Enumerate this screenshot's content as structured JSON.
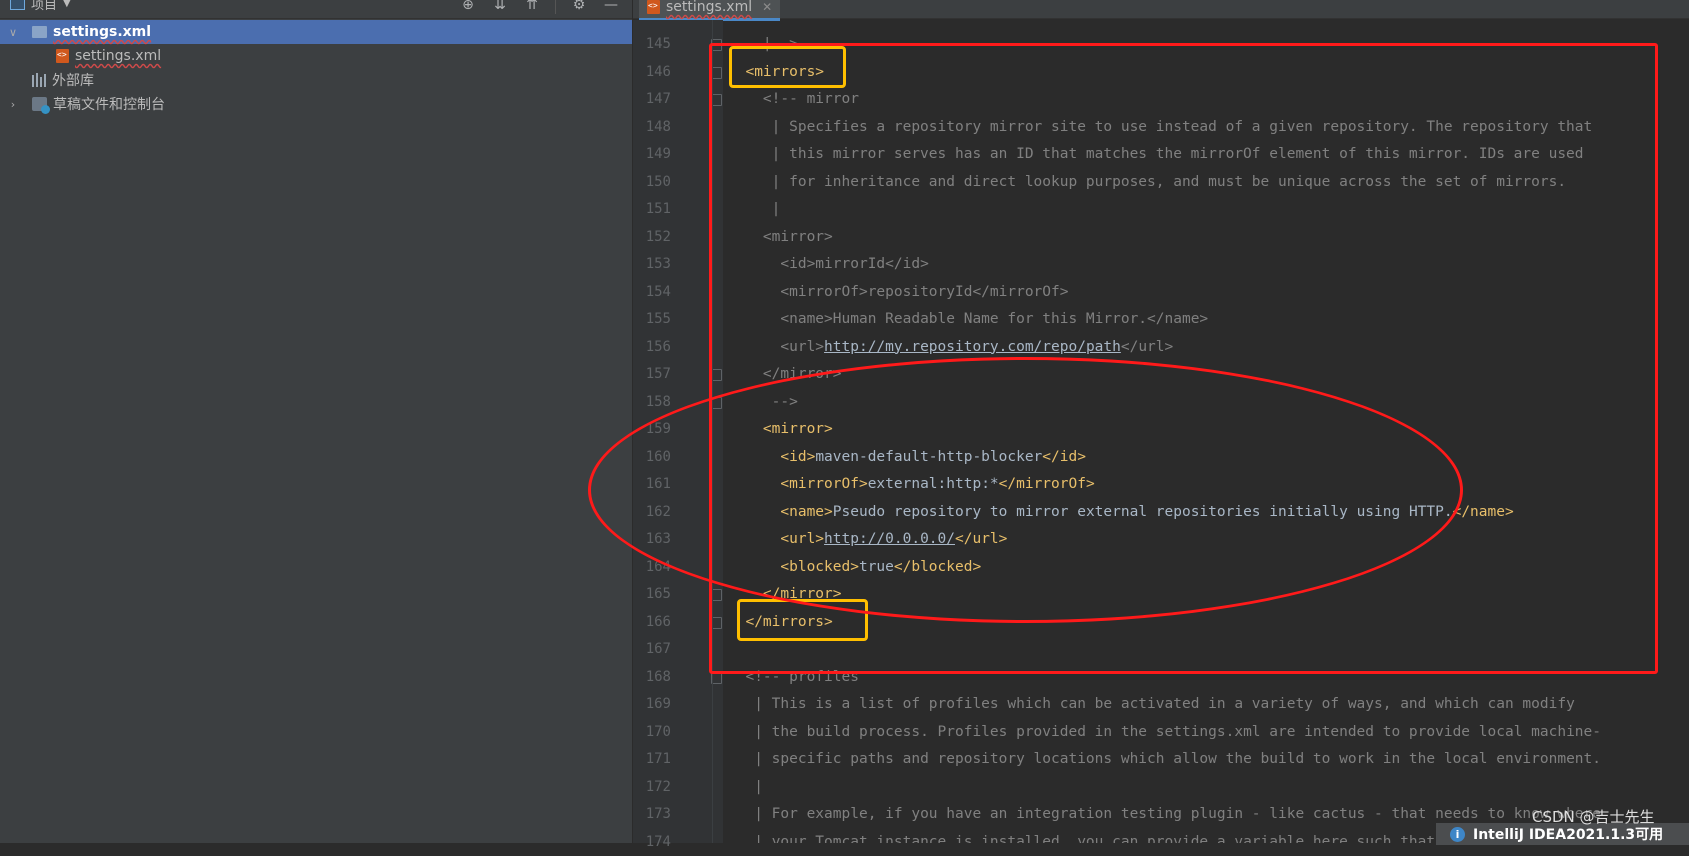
{
  "project_panel": {
    "title": "项目",
    "toolbar_icons": [
      "crosshair-icon",
      "expand-all-icon",
      "collapse-all-icon",
      "gear-icon",
      "minimize-icon"
    ],
    "tree": [
      {
        "label": "settings.xml",
        "type": "folder",
        "expanded": true,
        "selected": true
      },
      {
        "label": "settings.xml",
        "type": "xml-file"
      },
      {
        "label": "外部库",
        "type": "library"
      },
      {
        "label": "草稿文件和控制台",
        "type": "scratches",
        "expanded": false
      }
    ]
  },
  "editor": {
    "tab_label": "settings.xml",
    "line_numbers": [
      "145",
      "146",
      "147",
      "148",
      "149",
      "150",
      "151",
      "152",
      "153",
      "154",
      "155",
      "156",
      "157",
      "158",
      "159",
      "160",
      "161",
      "162",
      "163",
      "164",
      "165",
      "166",
      "167",
      "168",
      "169",
      "170",
      "171",
      "172",
      "173",
      "174"
    ],
    "lines": [
      {
        "indent": "    ",
        "parts": [
          {
            "c": "cm",
            "t": "|-->"
          }
        ]
      },
      {
        "indent": "  ",
        "parts": [
          {
            "c": "tg",
            "t": "<mirrors>"
          }
        ]
      },
      {
        "indent": "    ",
        "parts": [
          {
            "c": "cm",
            "t": "<!-- mirror"
          }
        ]
      },
      {
        "indent": "     ",
        "parts": [
          {
            "c": "cm",
            "t": "| Specifies a repository mirror site to use instead of a given repository. The repository that"
          }
        ]
      },
      {
        "indent": "     ",
        "parts": [
          {
            "c": "cm",
            "t": "| this mirror serves has an ID that matches the mirrorOf element of this mirror. IDs are used"
          }
        ]
      },
      {
        "indent": "     ",
        "parts": [
          {
            "c": "cm",
            "t": "| for inheritance and direct lookup purposes, and must be unique across the set of mirrors."
          }
        ]
      },
      {
        "indent": "     ",
        "parts": [
          {
            "c": "cm",
            "t": "|"
          }
        ]
      },
      {
        "indent": "    ",
        "parts": [
          {
            "c": "cm",
            "t": "<mirror>"
          }
        ]
      },
      {
        "indent": "      ",
        "parts": [
          {
            "c": "cm",
            "t": "<id>mirrorId</id>"
          }
        ]
      },
      {
        "indent": "      ",
        "parts": [
          {
            "c": "cm",
            "t": "<mirrorOf>repositoryId</mirrorOf>"
          }
        ]
      },
      {
        "indent": "      ",
        "parts": [
          {
            "c": "cm",
            "t": "<name>Human Readable Name for this Mirror.</name>"
          }
        ]
      },
      {
        "indent": "      ",
        "parts": [
          {
            "c": "cm",
            "t": "<url>"
          },
          {
            "c": "cm lk",
            "t": "http://my.repository.com/repo/path"
          },
          {
            "c": "cm",
            "t": "</url>"
          }
        ]
      },
      {
        "indent": "    ",
        "parts": [
          {
            "c": "cm",
            "t": "</mirror>"
          }
        ]
      },
      {
        "indent": "     ",
        "parts": [
          {
            "c": "cm",
            "t": "-->"
          }
        ]
      },
      {
        "indent": "    ",
        "parts": [
          {
            "c": "tg",
            "t": "<mirror>"
          }
        ]
      },
      {
        "indent": "      ",
        "parts": [
          {
            "c": "tg",
            "t": "<id>"
          },
          {
            "c": "tx",
            "t": "maven-default-http-blocker"
          },
          {
            "c": "tg",
            "t": "</id>"
          }
        ]
      },
      {
        "indent": "      ",
        "parts": [
          {
            "c": "tg",
            "t": "<mirrorOf>"
          },
          {
            "c": "tx",
            "t": "external:http:*"
          },
          {
            "c": "tg",
            "t": "</mirrorOf>"
          }
        ]
      },
      {
        "indent": "      ",
        "parts": [
          {
            "c": "tg",
            "t": "<name>"
          },
          {
            "c": "tx",
            "t": "Pseudo repository to mirror external repositories initially using HTTP."
          },
          {
            "c": "tg",
            "t": "</name>"
          }
        ]
      },
      {
        "indent": "      ",
        "parts": [
          {
            "c": "tg",
            "t": "<url>"
          },
          {
            "c": "lk",
            "t": "http://0.0.0.0/"
          },
          {
            "c": "tg",
            "t": "</url>"
          }
        ]
      },
      {
        "indent": "      ",
        "parts": [
          {
            "c": "tg",
            "t": "<blocked>"
          },
          {
            "c": "tx",
            "t": "true"
          },
          {
            "c": "tg",
            "t": "</blocked>"
          }
        ]
      },
      {
        "indent": "    ",
        "parts": [
          {
            "c": "tg",
            "t": "</mirror>"
          }
        ]
      },
      {
        "indent": "  ",
        "parts": [
          {
            "c": "tg",
            "t": "</mirrors>"
          }
        ]
      },
      {
        "indent": "",
        "parts": []
      },
      {
        "indent": "  ",
        "parts": [
          {
            "c": "cm",
            "t": "<!-- profiles"
          }
        ]
      },
      {
        "indent": "   ",
        "parts": [
          {
            "c": "cm",
            "t": "| This is a list of profiles which can be activated in a variety of ways, and which can modify"
          }
        ]
      },
      {
        "indent": "   ",
        "parts": [
          {
            "c": "cm",
            "t": "| the build process. Profiles provided in the settings.xml are intended to provide local machine-"
          }
        ]
      },
      {
        "indent": "   ",
        "parts": [
          {
            "c": "cm",
            "t": "| specific paths and repository locations which allow the build to work in the local environment."
          }
        ]
      },
      {
        "indent": "   ",
        "parts": [
          {
            "c": "cm",
            "t": "|"
          }
        ]
      },
      {
        "indent": "   ",
        "parts": [
          {
            "c": "cm",
            "t": "| For example, if you have an integration testing plugin - like cactus - that needs to know where"
          }
        ]
      },
      {
        "indent": "   ",
        "parts": [
          {
            "c": "cm",
            "t": "| your Tomcat instance is installed, you can provide a variable here such that the variable is"
          }
        ]
      }
    ]
  },
  "notification": {
    "text": "IntelliJ IDEA2021.1.3可用",
    "icon": "info-icon"
  },
  "watermark": "CSDN @吉士先生",
  "annotation_colors": {
    "red": "#ff1a1a",
    "yellow": "#ffbf00"
  }
}
